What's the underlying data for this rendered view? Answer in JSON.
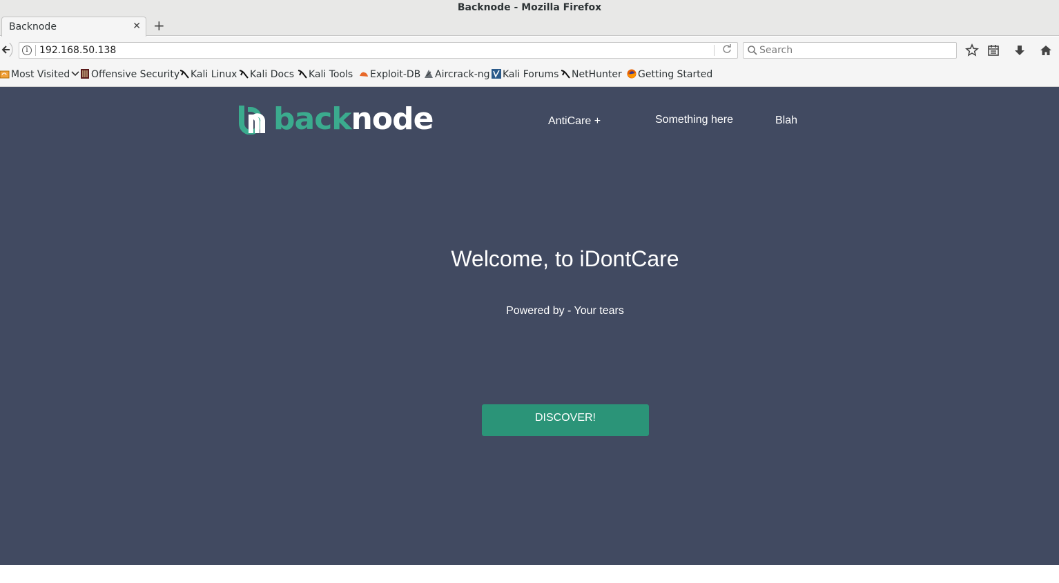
{
  "window": {
    "title": "Backnode - Mozilla Firefox"
  },
  "tabs": [
    {
      "title": "Backnode",
      "close_icon": "close-icon"
    }
  ],
  "new_tab_label": "+",
  "navbar": {
    "url": "192.168.50.138",
    "search_placeholder": "Search"
  },
  "bookmarks": [
    {
      "label": "Most Visited",
      "icon": "folder-icon"
    },
    {
      "label": "Offensive Security",
      "icon": "offsec-icon"
    },
    {
      "label": "Kali Linux",
      "icon": "kali-dragon-icon"
    },
    {
      "label": "Kali Docs",
      "icon": "kali-dragon-icon"
    },
    {
      "label": "Kali Tools",
      "icon": "kali-dragon-icon"
    },
    {
      "label": "Exploit-DB",
      "icon": "exploit-db-icon"
    },
    {
      "label": "Aircrack-ng",
      "icon": "aircrack-icon"
    },
    {
      "label": "Kali Forums",
      "icon": "kali-forums-icon"
    },
    {
      "label": "NetHunter",
      "icon": "kali-dragon-icon"
    },
    {
      "label": "Getting Started",
      "icon": "firefox-icon"
    }
  ],
  "site": {
    "logo": {
      "part1": "back",
      "part2": "node"
    },
    "nav": [
      "AntiCare +",
      "Something here",
      "Blah"
    ],
    "hero_title": "Welcome, to iDontCare",
    "hero_subtitle": "Powered by - Your tears",
    "cta_label": "DISCOVER!"
  },
  "colors": {
    "page_background": "#414a61",
    "brand_green": "#3bab8e",
    "button_green": "#2b9478"
  }
}
